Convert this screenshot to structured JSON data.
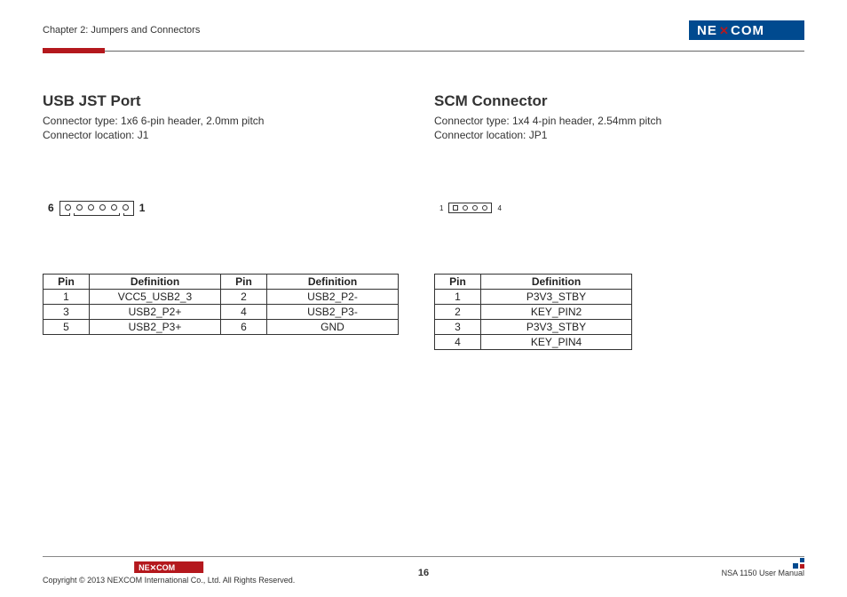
{
  "header": {
    "chapter": "Chapter 2: Jumpers and Connectors"
  },
  "left": {
    "title": "USB JST Port",
    "type": "Connector type: 1x6 6-pin header, 2.0mm pitch",
    "loc": "Connector location: J1",
    "diagram": {
      "leftLabel": "6",
      "rightLabel": "1"
    },
    "table": {
      "headers": [
        "Pin",
        "Definition",
        "Pin",
        "Definition"
      ],
      "rows": [
        [
          "1",
          "VCC5_USB2_3",
          "2",
          "USB2_P2-"
        ],
        [
          "3",
          "USB2_P2+",
          "4",
          "USB2_P3-"
        ],
        [
          "5",
          "USB2_P3+",
          "6",
          "GND"
        ]
      ]
    }
  },
  "right": {
    "title": "SCM Connector",
    "type": "Connector type: 1x4 4-pin header, 2.54mm pitch",
    "loc": "Connector location: JP1",
    "diagram": {
      "leftLabel": "1",
      "rightLabel": "4"
    },
    "table": {
      "headers": [
        "Pin",
        "Definition"
      ],
      "rows": [
        [
          "1",
          "P3V3_STBY"
        ],
        [
          "2",
          "KEY_PIN2"
        ],
        [
          "3",
          "P3V3_STBY"
        ],
        [
          "4",
          "KEY_PIN4"
        ]
      ]
    }
  },
  "footer": {
    "copyright": "Copyright © 2013 NEXCOM International Co., Ltd. All Rights Reserved.",
    "page": "16",
    "manual": "NSA 1150 User Manual"
  }
}
